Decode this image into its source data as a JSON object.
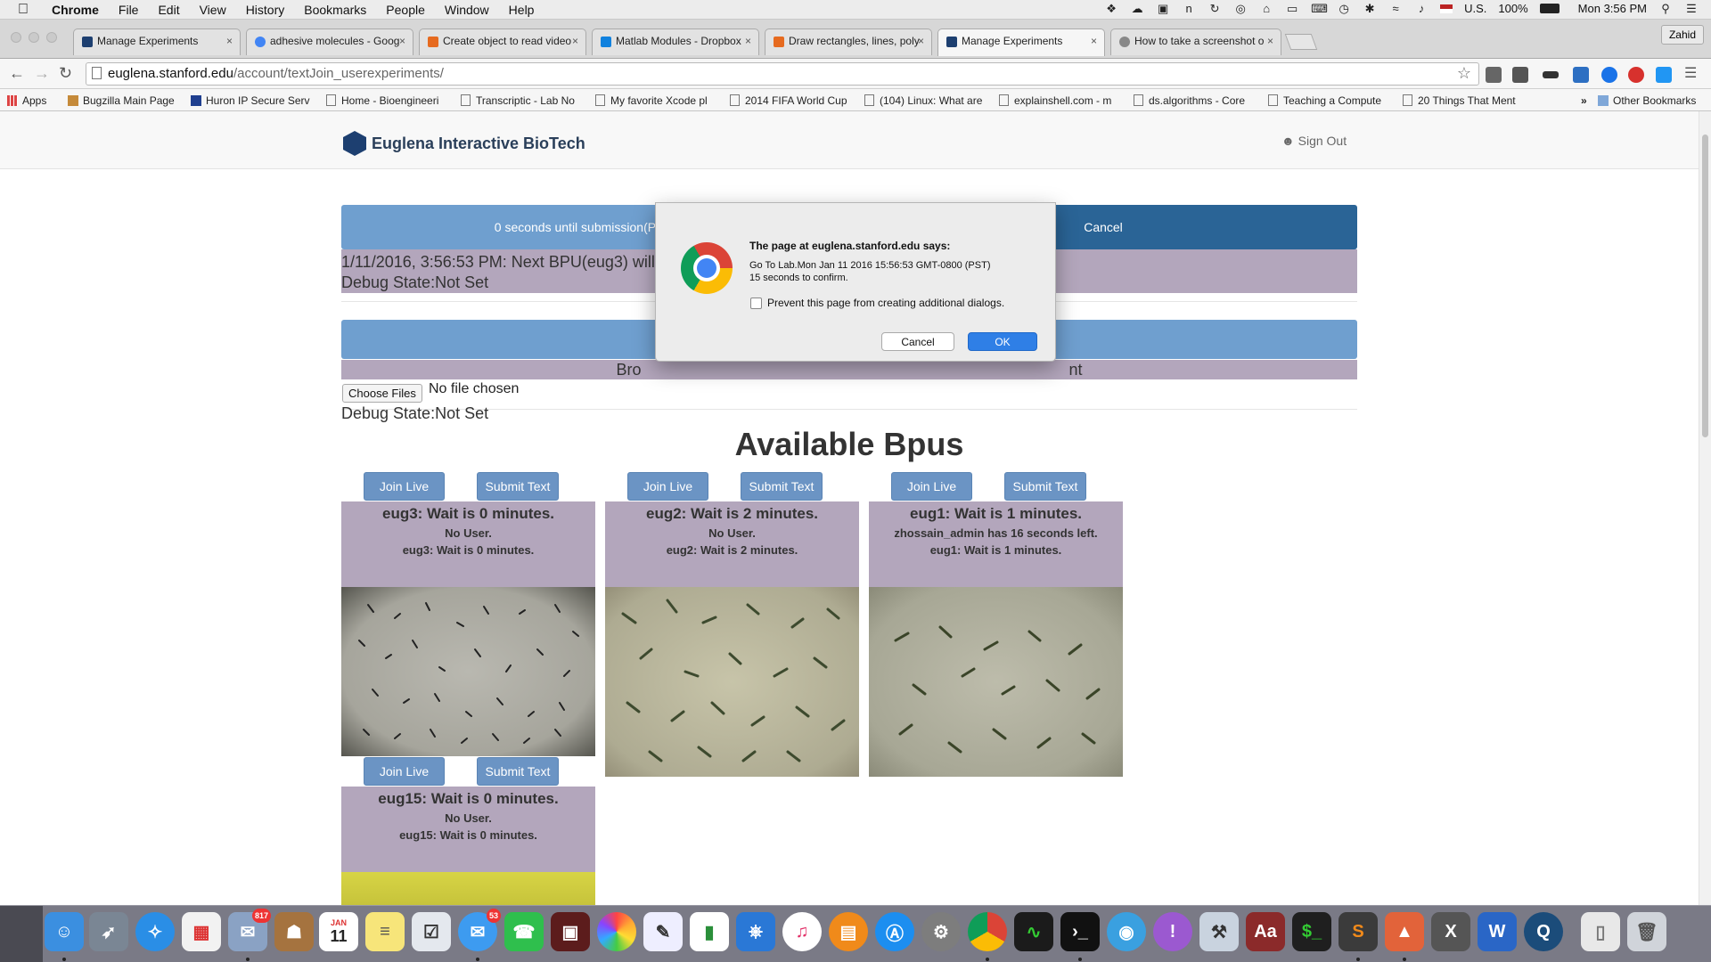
{
  "menubar": {
    "app": "Chrome",
    "items": [
      "File",
      "Edit",
      "View",
      "History",
      "Bookmarks",
      "People",
      "Window",
      "Help"
    ],
    "input_source": "U.S.",
    "battery": "100%",
    "clock": "Mon 3:56 PM"
  },
  "tabs": [
    {
      "label": "Manage Experiments",
      "favicon_color": "#1d3f70",
      "active": false
    },
    {
      "label": "adhesive molecules - Goog",
      "favicon_color": "#4285f4",
      "active": false
    },
    {
      "label": "Create object to read video",
      "favicon_color": "#e66a1f",
      "active": false
    },
    {
      "label": "Matlab Modules - Dropbox",
      "favicon_color": "#1081de",
      "active": false
    },
    {
      "label": "Draw rectangles, lines, poly",
      "favicon_color": "#e66a1f",
      "active": false
    },
    {
      "label": "Manage Experiments",
      "favicon_color": "#1d3f70",
      "active": true
    },
    {
      "label": "How to take a screenshot o",
      "favicon_color": "#888888",
      "active": false
    }
  ],
  "profile_name": "Zahid",
  "address": {
    "host": "euglena.stanford.edu",
    "path": "/account/textJoin_userexperiments/"
  },
  "bookmarks": {
    "apps": "Apps",
    "items": [
      "Bugzilla Main Page",
      "Huron IP Secure Serv",
      "Home - Bioengineeri",
      "Transcriptic - Lab No",
      "My favorite Xcode pl",
      "2014 FIFA World Cup",
      "(104) Linux: What are",
      "explainshell.com - m",
      "ds.algorithms - Core",
      "Teaching a Compute",
      "20 Things That Ment"
    ],
    "overflow": "»",
    "other": "Other Bookmarks"
  },
  "site": {
    "brand": "Euglena Interactive BioTech",
    "signout": "Sign Out",
    "submission_bar": "0 seconds until submission(Package",
    "cancel": "Cancel",
    "status_line": "1/11/2016, 3:56:53 PM: Next BPU(eug3) will",
    "debug1": "Debug State:Not Set",
    "browse_fragment_left": "Bro",
    "browse_fragment_right": "nt",
    "choose_files": "Choose Files",
    "no_file": "No file chosen",
    "debug2": "Debug State:Not Set",
    "available_title": "Available Bpus"
  },
  "bpus": [
    {
      "join": "Join Live",
      "submit": "Submit Text",
      "heading": "eug3: Wait is 0 minutes.",
      "user": "No User.",
      "wait": "eug3: Wait is 0 minutes."
    },
    {
      "join": "Join Live",
      "submit": "Submit Text",
      "heading": "eug2: Wait is 2 minutes.",
      "user": "No User.",
      "wait": "eug2: Wait is 2 minutes."
    },
    {
      "join": "Join Live",
      "submit": "Submit Text",
      "heading": "eug1: Wait is 1 minutes.",
      "user": "zhossain_admin has 16 seconds left.",
      "wait": "eug1: Wait is 1 minutes."
    },
    {
      "join": "Join Live",
      "submit": "Submit Text",
      "heading": "eug15: Wait is 0 minutes.",
      "user": "No User.",
      "wait": "eug15: Wait is 0 minutes."
    }
  ],
  "dialog": {
    "title": "The page at euglena.stanford.edu says:",
    "line1": "Go To Lab.Mon Jan 11 2016 15:56:53 GMT-0800 (PST)",
    "line2": "15 seconds to confirm.",
    "checkbox_label": "Prevent this page from creating additional dialogs.",
    "cancel": "Cancel",
    "ok": "OK"
  },
  "dock": {
    "badges": {
      "mail": "817",
      "messages": "53"
    },
    "calendar_month": "JAN",
    "calendar_day": "11",
    "pdf_label": "Aa"
  }
}
